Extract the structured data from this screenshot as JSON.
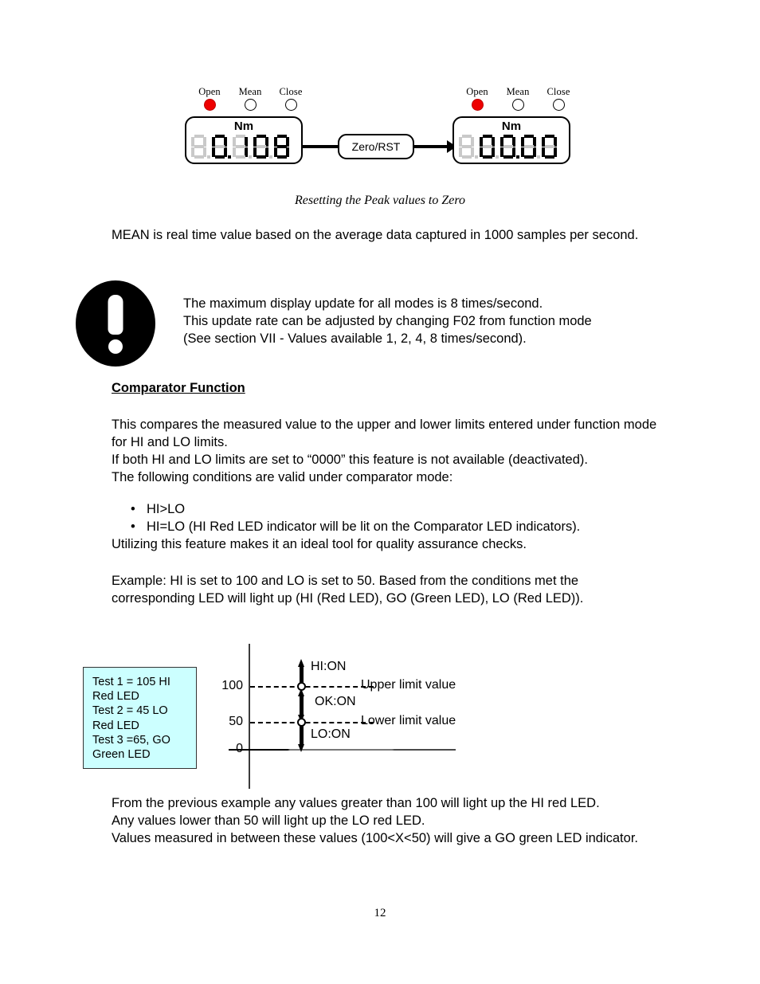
{
  "figure_top": {
    "caption": "Resetting the Peak values to Zero",
    "led_labels": [
      "Open",
      "Mean",
      "Close"
    ],
    "left_meter": {
      "unit": "Nm",
      "display_value": "0.108",
      "leds": [
        {
          "label": "Open",
          "state": "on",
          "color": "#ee0000"
        },
        {
          "label": "Mean",
          "state": "off"
        },
        {
          "label": "Close",
          "state": "off"
        }
      ]
    },
    "right_meter": {
      "unit": "Nm",
      "display_value": "00.00",
      "leds": [
        {
          "label": "Open",
          "state": "on",
          "color": "#ee0000"
        },
        {
          "label": "Mean",
          "state": "off"
        },
        {
          "label": "Close",
          "state": "off"
        }
      ]
    },
    "reset_button_label": "Zero/RST"
  },
  "body": {
    "para_mean": "MEAN is real time value based on the average data captured in 1000 samples per second.",
    "warning": {
      "icon": "exclamation-icon",
      "line1": "The maximum display update for all modes is 8 times/second.",
      "line2": "This update rate can be adjusted by changing F02 from function mode",
      "line3": "(See section VII - Values available 1, 2, 4, 8 times/second)."
    },
    "comparator_heading": "Comparator Function",
    "para_compare_1": "This compares the measured value to the upper and lower limits entered under function mode for HI and LO limits.",
    "para_compare_2": "If both HI and LO limits are set to “0000” this feature is not available (deactivated).",
    "para_compare_3": "The following conditions are valid under comparator mode:",
    "bullets": [
      "HI>LO",
      "HI=LO (HI Red LED indicator will be lit on the Comparator LED indicators)."
    ],
    "para_utilize": "Utilizing this feature makes it an ideal tool for quality assurance checks.",
    "para_example": "Example:  HI is set to 100 and LO is set to 50.  Based from the conditions met the corresponding LED will light up (HI (Red LED),  GO (Green LED), LO (Red LED)).",
    "para_from_previous_1": "From the previous example any values greater than 100 will light up the HI red LED.",
    "para_from_previous_2": "Any values lower than 50 will light up the LO red LED.",
    "para_from_previous_3": "Values measured in between these values (100<X<50) will give a GO green LED indicator."
  },
  "comparator_chart": {
    "legend_box": {
      "background_color": "#CCFFFF",
      "lines": [
        "Test 1 = 105 HI",
        "Red LED",
        "Test 2 = 45 LO",
        "Red LED",
        "Test 3 =65, GO",
        "Green LED"
      ]
    },
    "y_ticks": [
      "100",
      "50",
      "0"
    ],
    "annotations": {
      "hi": "HI:ON",
      "ok": "OK:ON",
      "lo": "LO:ON",
      "upper_limit": "Upper limit value",
      "lower_limit": "Lower limit value"
    }
  },
  "chart_data": {
    "type": "line",
    "title": "",
    "xlabel": "",
    "ylabel": "",
    "ylim": [
      0,
      130
    ],
    "grid": false,
    "legend_position": "left",
    "y_tick_values": [
      0,
      50,
      100
    ],
    "y_tick_labels": [
      "0",
      "50",
      "100"
    ],
    "thresholds": [
      {
        "name": "Upper limit value",
        "value": 100,
        "style": "dashed",
        "marker": "open-circle"
      },
      {
        "name": "Lower limit value",
        "value": 50,
        "style": "dashed",
        "marker": "open-circle"
      }
    ],
    "zones": [
      {
        "label": "HI:ON",
        "range": [
          100,
          130
        ],
        "direction": "up",
        "led": "Red"
      },
      {
        "label": "OK:ON",
        "range": [
          50,
          100
        ],
        "direction": "both",
        "led": "Green"
      },
      {
        "label": "LO:ON",
        "range": [
          0,
          50
        ],
        "direction": "down",
        "led": "Red"
      }
    ],
    "test_points": [
      {
        "name": "Test 1",
        "value": 105,
        "result": "HI",
        "led": "Red LED"
      },
      {
        "name": "Test 2",
        "value": 45,
        "result": "LO",
        "led": "Red LED"
      },
      {
        "name": "Test 3",
        "value": 65,
        "result": "GO",
        "led": "Green LED"
      }
    ]
  },
  "page_number": "12"
}
